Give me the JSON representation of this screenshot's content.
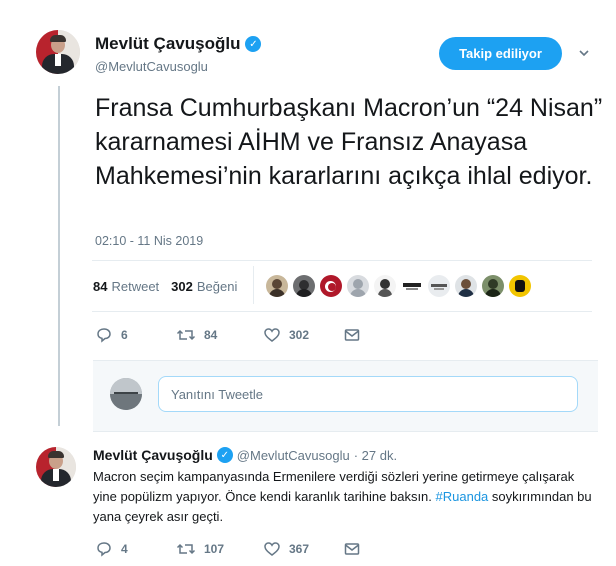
{
  "tweet": {
    "author_name": "Mevlüt Çavuşoğlu",
    "author_handle": "@MevlutCavusoglu",
    "follow_label": "Takip ediliyor",
    "text": "Fransa Cumhurbaşkanı Macron’un “24 Nisan” kararnamesi AİHM ve Fransız Anayasa Mahkemesi’nin kararlarını açıkça ihlal ediyor.",
    "timestamp": "02:10 - 11 Nis 2019",
    "retweet_count": "84",
    "retweet_label": "Retweet",
    "like_count": "302",
    "like_label": "Beğeni",
    "actions": {
      "replies": "6",
      "retweets": "84",
      "likes": "302"
    }
  },
  "reply_box": {
    "placeholder": "Yanıtını Tweetle"
  },
  "reply": {
    "author_name": "Mevlüt Çavuşoğlu",
    "author_handle": "@MevlutCavusoglu",
    "time": "· 27 dk.",
    "text_before": "Macron seçim kampanyasında Ermenilere verdiği sözleri yerine getirmeye çalışarak  yine popülizm yapıyor. Önce kendi karanlık tarihine baksın. ",
    "hashtag": "#Ruanda",
    "text_after": " soykırımından bu yana çeyrek asır geçti.",
    "actions": {
      "replies": "4",
      "retweets": "107",
      "likes": "367"
    }
  },
  "colors": {
    "accent": "#1da1f2",
    "link": "#1b95e0",
    "muted": "#657786"
  }
}
